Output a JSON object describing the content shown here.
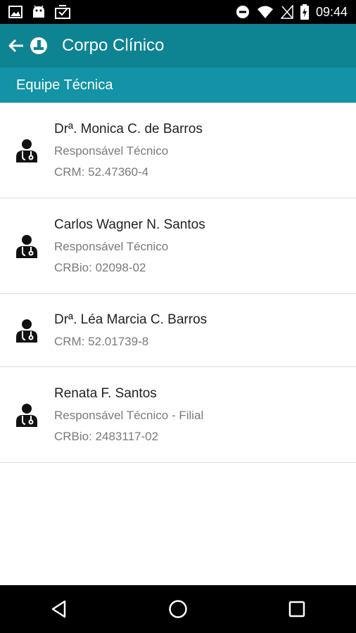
{
  "status_bar": {
    "time": "09:44",
    "icons": [
      "image-icon",
      "android-icon",
      "download-icon",
      "dnd-icon",
      "wifi-icon",
      "no-signal-icon",
      "battery-charging-icon"
    ]
  },
  "app_bar": {
    "title": "Corpo Clínico",
    "back_icon": "arrow-back-icon",
    "logo_icon": "app-logo-icon"
  },
  "section": {
    "title": "Equipe Técnica"
  },
  "staff": [
    {
      "name": "Drª. Monica C. de Barros",
      "role": "Responsável Técnico",
      "registry": "CRM: 52.47360-4",
      "icon": "doctor-icon"
    },
    {
      "name": "Carlos Wagner N. Santos",
      "role": "Responsável Técnico",
      "registry": "CRBio: 02098-02",
      "icon": "doctor-icon"
    },
    {
      "name": "Drª. Léa Marcia C. Barros",
      "role": "",
      "registry": "CRM: 52.01739-8",
      "icon": "doctor-icon"
    },
    {
      "name": "Renata F. Santos",
      "role": "Responsável Técnico - Filial",
      "registry": "CRBio: 2483117-02",
      "icon": "doctor-icon"
    }
  ],
  "nav_bar": {
    "icons": [
      "back-triangle-icon",
      "home-circle-icon",
      "recents-square-icon"
    ]
  },
  "colors": {
    "app_bar": "#0e8493",
    "sub_header": "#1393a5",
    "text_primary": "#222222",
    "text_secondary": "#7a7a7a"
  }
}
